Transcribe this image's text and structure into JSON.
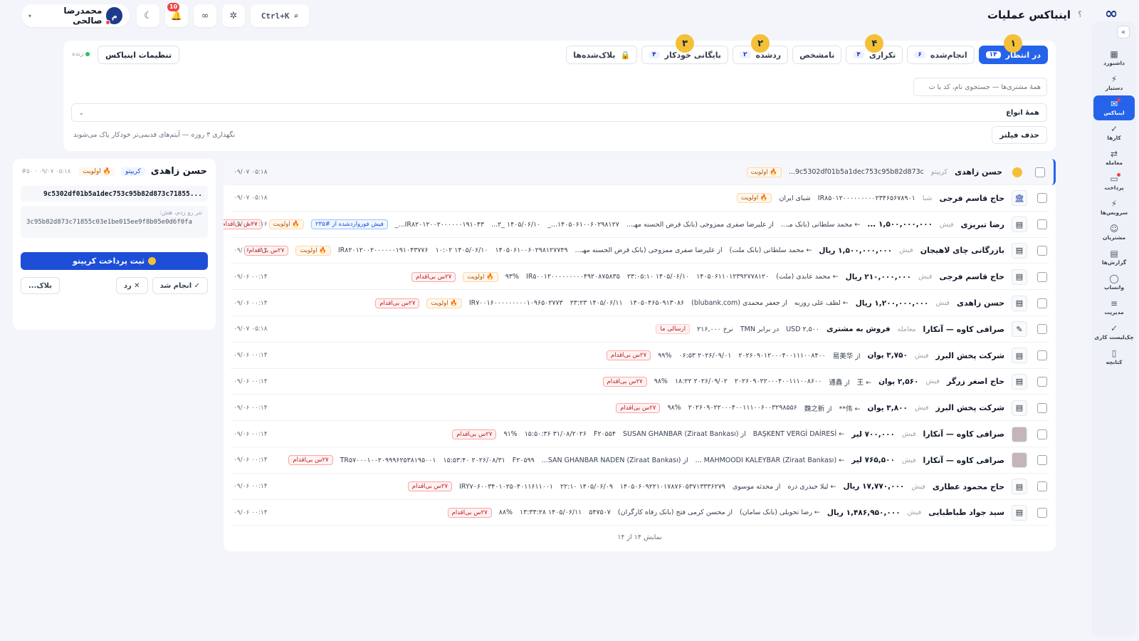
{
  "header": {
    "title": "اینباکس عملیات",
    "help": "؟",
    "logo": "∞",
    "search_shortcut": "Ctrl+K",
    "notification_count": "10",
    "user_name": "محمدرضا صالحی",
    "user_initial": "م"
  },
  "sidebar": {
    "items": [
      {
        "label": "داشبورد",
        "icon": "▦"
      },
      {
        "label": "دستیار",
        "icon": "⚡"
      },
      {
        "label": "اینباکس",
        "icon": "✉"
      },
      {
        "label": "کارها",
        "icon": "✓"
      },
      {
        "label": "معامله",
        "icon": "⇄"
      },
      {
        "label": "پرداخت",
        "icon": "▭"
      },
      {
        "label": "سرویس‌ها",
        "icon": "⚡"
      },
      {
        "label": "مشتریان",
        "icon": "☺"
      },
      {
        "label": "گزارش‌ها",
        "icon": "▤"
      },
      {
        "label": "واتساپ",
        "icon": "◯"
      },
      {
        "label": "مدیریت",
        "icon": "≡"
      },
      {
        "label": "چک‌لیست کاری",
        "icon": "✓"
      },
      {
        "label": "کتابچه",
        "icon": "▯"
      }
    ]
  },
  "tabs": [
    {
      "label": "در انتظار",
      "count": "۱۴",
      "step": "۱"
    },
    {
      "label": "انجام‌شده",
      "count": "۶",
      "step": ""
    },
    {
      "label": "تکراری",
      "count": "۴",
      "step": "۴"
    },
    {
      "label": "نامشخص",
      "count": "",
      "step": ""
    },
    {
      "label": "ردشده",
      "count": "۲",
      "step": "۲"
    },
    {
      "label": "بایگانی خودکار",
      "count": "۴",
      "step": "۳"
    },
    {
      "label": "بلاک‌شده‌ها",
      "count": "",
      "step": ""
    }
  ],
  "filters": {
    "settings_label": "تنظیمات اینباکس",
    "live_label": "زنده",
    "search_placeholder": "همهٔ مشتری‌ها — جستجوی نام، کد یا ت",
    "type_select": "همهٔ انواع",
    "clear_label": "حذف فیلتر",
    "retention_note": "نگهداری ۳ روزه — آیتم‌های قدیمی‌تر خودکار پاک می‌شوند"
  },
  "list": {
    "footer": "نمایش ۱۴ از ۱۴",
    "rows": [
      {
        "name": "حسن زاهدی",
        "type": "کریپتو",
        "thumb": "coin",
        "parts": [
          "9c5302df01b5a1dec753c95b82d873c..."
        ],
        "chips": [
          {
            "t": "🔥 اولویت",
            "k": "pri"
          }
        ],
        "time": "۰۹/۰۷ ۰۵:۱۸"
      },
      {
        "name": "حاج قاسم فرجی",
        "type": "شبا",
        "thumb": "bank",
        "parts": [
          "IR۸۵۰۱۲۰۰۰۰۰۰۰۰۰۲۳۴۶۵۶۷۸۹۰۱",
          "شبای ایران"
        ],
        "chips": [
          {
            "t": "🔥 اولویت",
            "k": "pri"
          }
        ],
        "time": "۰۹/۰۷ ۰۵:۱۸"
      },
      {
        "name": "رضا تبریزی",
        "type": "فیش",
        "thumb": "doc",
        "amount": "۱,۵۰۰,۰۰۰,۰۰۰ ...",
        "parts": [
          "← محمد سلطانی (بانک مـ...",
          "از علیرضا صفری ممزوجی (بانک قرض الحسنه مهـ...",
          "۱۴۰۵۰۶۱۰۰۶۰۲۹۸۱۲۷..._",
          "۱۴۰۵/۰۶/۱۰ _۲...",
          "IR۸۲۰۱۲۰۰۲۰۰۰۰۰۰۱۹۱۰۴۳..._"
        ],
        "chips": [
          {
            "t": "فیش فورواردشده از #۲۳۵",
            "k": "fwd"
          },
          {
            "t": "🔥 اولویت",
            "k": "pri"
          },
          {
            "t": "۲۷س بی‌اقدام",
            "k": "late"
          }
        ],
        "time": "۰۹/۰۶ ۰۰:۱۶"
      },
      {
        "name": "بازرگانی چای لاهیجان",
        "type": "فیش",
        "thumb": "doc",
        "amount": "۱,۵۰۰,۰۰۰,۰۰۰ ریال",
        "parts": [
          "← محمد سلطانی (بانک ملت)",
          "از علیرضا صفری ممزوجی (بانک قرض الحسنه مهـ...",
          "۱۴۰۵۰۶۱۰۰۶۰۲۹۸۱۲۷۷۴۹",
          "۱۴۰۵/۰۶/۱۰ ۱۰:۰۲",
          "IR۸۲۰۱۲۰۰۲۰۰۰۰۰۰۱۹۱۰۴۳۷۷۶"
        ],
        "chips": [
          {
            "t": "🔥 اولویت",
            "k": "pri"
          },
          {
            "t": "۲۷س بی‌اقدام",
            "k": "late"
          }
        ],
        "time": "۰۹/۰۶ ۰۰:۱۴"
      },
      {
        "name": "حاج قاسم فرجی",
        "type": "فیش",
        "thumb": "doc",
        "amount": "۲۱۰,۰۰۰,۰۰۰ ریال",
        "parts": [
          "← محمد عابدی (ملت)",
          "۱۴۰۵۰۶۱۱۰۱۲۳۹۲۷۷۸۱۲۰",
          "۱۴۰۵/۰۶/۱۰ ۲۳:۰۵:۱۰",
          "IR۵۰۰۱۲۰۰۰۰۰۰۰۰۰۴۹۲۰۸۷۵۸۳۵",
          "۹۳%"
        ],
        "chips": [
          {
            "t": "🔥 اولویت",
            "k": "pri"
          },
          {
            "t": "۲۷س بی‌اقدام",
            "k": "late"
          }
        ],
        "time": "۰۹/۰۶ ۰۰:۱۴"
      },
      {
        "name": "حسن زاهدی",
        "type": "فیش",
        "thumb": "doc",
        "amount": "۱,۲۰۰,۰۰۰,۰۰۰ ریال",
        "parts": [
          "← لطف علی روزبه",
          "از جعفر محمدی (blubank.com)",
          "۱۴۰۵۰۴۶۵۰۹۱۳۰۸۶",
          "۱۴۰۵/۰۶/۱۱ ۲۳:۲۳",
          "IR۷۰۰۱۶۰۰۰۰۰۰۰۰۰۱۰۹۶۵۰۲۷۷۳"
        ],
        "chips": [
          {
            "t": "🔥 اولویت",
            "k": "pri"
          },
          {
            "t": "۲۷س بی‌اقدام",
            "k": "late"
          }
        ],
        "time": "۰۹/۰۶ ۰۰:۱۴"
      },
      {
        "name": "صرافی کاوه — آنکارا",
        "type": "معامله",
        "thumb": "note",
        "amount": "فروش به مشتری",
        "parts": [
          "USD ۲,۵۰۰",
          "در برابر TMN",
          "نرخ ۲۱۶,۰۰۰"
        ],
        "chips": [
          {
            "t": "ارسالی ما",
            "k": "sent"
          }
        ],
        "time": "۰۹/۰۷ ۰۵:۱۸"
      },
      {
        "name": "شرکت پخش البرز",
        "type": "فیش",
        "thumb": "doc",
        "amount": "۳,۷۵۰ یوان",
        "parts": [
          "از 易美华",
          "۲۰۲۶۰۹۰۱۲۰۰۰۴۰۰۱۱۱۰۰۸۴۰۰",
          "۲۰۲۶/۰۹/۰۱ ۰۶:۵۳",
          "۹۹%"
        ],
        "chips": [
          {
            "t": "۲۷س بی‌اقدام",
            "k": "late"
          }
        ],
        "time": "۰۹/۰۶ ۰۰:۱۴"
      },
      {
        "name": "حاج اصغر زرگر",
        "type": "فیش",
        "thumb": "doc",
        "amount": "۲,۵۶۰ یوان",
        "parts": [
          "← 王",
          "از 通鑫",
          "۲۰۲۶۰۹۰۲۲۰۰۰۴۰۰۱۱۱۰۰۸۶۰۰",
          "۲۰۲۶/۰۹/۰۲ ۱۸:۲۲",
          "۹۸%"
        ],
        "chips": [
          {
            "t": "۲۷س بی‌اقدام",
            "k": "late"
          }
        ],
        "time": "۰۹/۰۶ ۰۰:۱۴"
      },
      {
        "name": "شرکت پخش البرز",
        "type": "فیش",
        "thumb": "doc",
        "amount": "۳,۸۰۰ یوان",
        "parts": [
          "← 伟**",
          "از 魏之新",
          "۲۰۲۶۰۹۰۲۲۰۰۰۴۰۰۱۱۱۰۰۶۰۰۳۲۹۸۵۵۶",
          "۹۸%"
        ],
        "chips": [
          {
            "t": "۲۷س بی‌اقدام",
            "k": "late"
          }
        ],
        "time": "۰۹/۰۶ ۰۰:۱۴"
      },
      {
        "name": "صرافی کاوه — آنکارا",
        "type": "فیش",
        "thumb": "dark",
        "amount": "۷۰۰,۰۰۰ لیر",
        "parts": [
          "← BAŞKENT VERGİ DAİRESİ",
          "از SUSAN GHANBAR (Ziraat Bankası)",
          "F۲۰۵۵۴",
          "۳۱/۰۸/۲۰۲۶ ۱۵:۵۰:۳۶",
          "۹۱%"
        ],
        "chips": [
          {
            "t": "۲۷س بی‌اقدام",
            "k": "late"
          }
        ],
        "time": "۰۹/۰۶ ۰۰:۱۴"
      },
      {
        "name": "صرافی کاوه — آنکارا",
        "type": "فیش",
        "thumb": "dark",
        "amount": "۷۶۵,۵۰۰ لیر",
        "parts": [
          "← MAHMOODI KALEYBAR (Ziraat Bankası) ...",
          "از SAN GHANBAR NADEN (Ziraat Bankası)...",
          "F۲۰۵۹۹",
          "۲۰۲۶/۰۸/۳۱ ۱۵:۵۳:۴۰",
          "TR۵۷۰۰۰۱۰۰۲۰۹۹۹۶۲۵۳۸۱۹۵۰۰۱"
        ],
        "chips": [
          {
            "t": "۲۷س بی‌اقدام",
            "k": "late"
          }
        ],
        "time": "۰۹/۰۶ ۰۰:۱۴"
      },
      {
        "name": "حاج محمود عطاری",
        "type": "فیش",
        "thumb": "doc",
        "amount": "۱۷,۷۷۰,۰۰۰ ریال",
        "parts": [
          "← لیلا حیدری دره",
          "از محدثه موسوی",
          "۱۴۰۵۰۶۰۹۲۲۱۰۱۷۸۷۶۰۵۳۷۱۳۳۳۶۲۷۹",
          "۱۴۰۵/۰۶/۰۹ ۲۲:۱۰",
          "IRY۷۰۶۰۰۳۴۰۱۰۲۵۰۴۰۱۱۶۱۱۰۰۱"
        ],
        "chips": [
          {
            "t": "۲۷س بی‌اقدام",
            "k": "late"
          }
        ],
        "time": "۰۹/۰۶ ۰۰:۱۴"
      },
      {
        "name": "سید جواد طباطبایی",
        "type": "فیش",
        "thumb": "doc",
        "amount": "۱,۴۸۶,۹۵۰,۰۰۰ ریال",
        "parts": [
          "← رضا تحویلی (بانک سامان)",
          "از محسن کرمی فتح (بانک رفاه کارگران)",
          "۵۴۷۵۰۷",
          "۱۴۰۵/۰۶/۱۱ ۱۳:۳۳:۲۸",
          "۸۸%"
        ],
        "chips": [
          {
            "t": "۲۷س بی‌اقدام",
            "k": "late"
          }
        ],
        "time": "۰۹/۰۶ ۰۰:۱۴"
      }
    ]
  },
  "detail": {
    "name": "حسن زاهدی",
    "type_chip": "کریپتو",
    "priority_chip": "🔥 اولویت",
    "meta": "#۵۰ · ۰۹/۰۷ ۰۵:۱۸",
    "hash": "9c5302df01b5a1dec753c95b82d873c71855...",
    "network_label": "تتر رو زدم، هش:",
    "address": "3c95b82d873c71855c03e1be015ee9f8b05e0d6f0fa",
    "primary_label": "ثبت پرداخت کریپتو",
    "done_label": "✓ انجام شد",
    "reject_label": "✕ رد",
    "block_label": "بلاک..."
  }
}
